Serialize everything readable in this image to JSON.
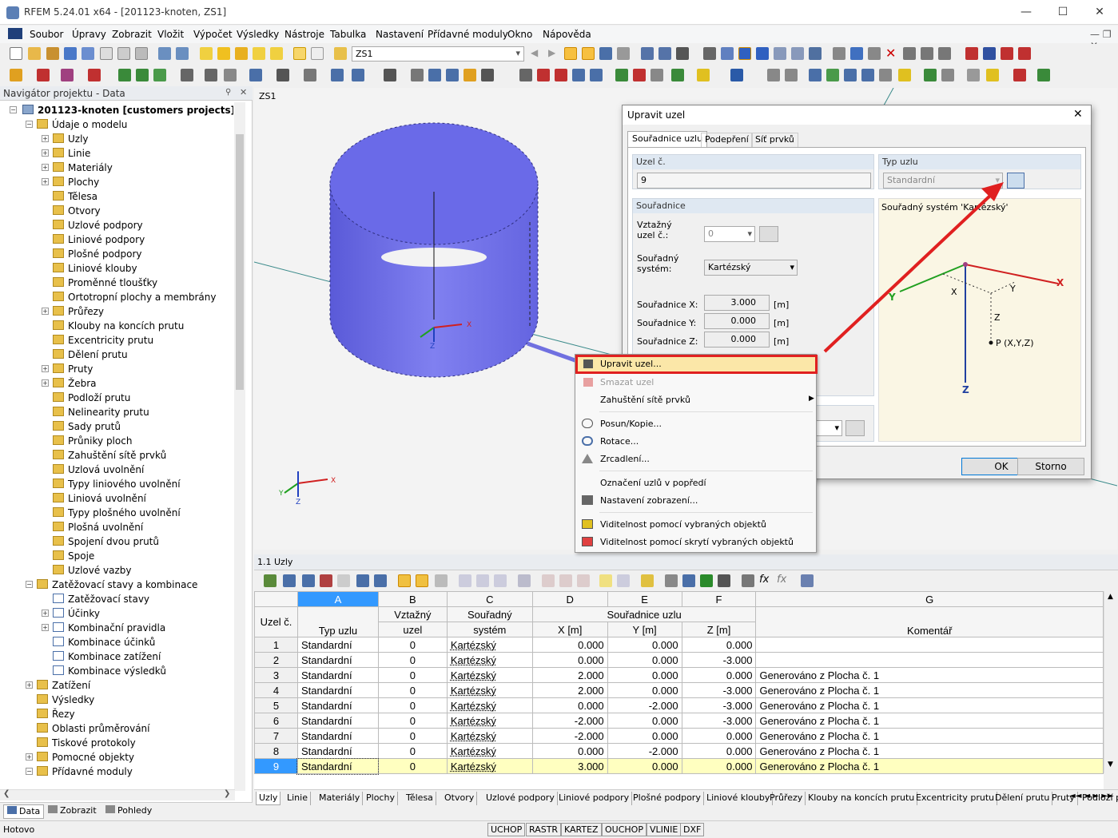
{
  "window": {
    "title": "RFEM 5.24.01 x64 - [201123-knoten, ZS1]"
  },
  "menu": [
    "Soubor",
    "Úpravy",
    "Zobrazit",
    "Vložit",
    "Výpočet",
    "Výsledky",
    "Nástroje",
    "Tabulka",
    "Nastavení",
    "Přídavné moduly",
    "Okno",
    "Nápověda"
  ],
  "toolbar": {
    "loadcase": "ZS1"
  },
  "navigator": {
    "header": "Navigátor projektu - Data",
    "root": "201123-knoten [customers projects]",
    "items": [
      "Údaje o modelu",
      "Uzly",
      "Linie",
      "Materiály",
      "Plochy",
      "Tělesa",
      "Otvory",
      "Uzlové podpory",
      "Liniové podpory",
      "Plošné podpory",
      "Liniové klouby",
      "Proměnné tloušťky",
      "Ortotropní plochy a membrány",
      "Průřezy",
      "Klouby na koncích prutu",
      "Excentricity prutu",
      "Dělení prutu",
      "Pruty",
      "Žebra",
      "Podloží prutu",
      "Nelinearity prutu",
      "Sady prutů",
      "Průniky ploch",
      "Zahuštění sítě prvků",
      "Uzlová uvolnění",
      "Typy liniového uvolnění",
      "Liniová uvolnění",
      "Typy plošného uvolnění",
      "Plošná uvolnění",
      "Spojení dvou prutů",
      "Spoje",
      "Uzlové vazby",
      "Zatěžovací stavy a kombinace",
      "Zatěžovací stavy",
      "Účinky",
      "Kombinační pravidla",
      "Kombinace účinků",
      "Kombinace zatížení",
      "Kombinace výsledků",
      "Zatížení",
      "Výsledky",
      "Řezy",
      "Oblasti průměrování",
      "Tiskové protokoly",
      "Pomocné objekty",
      "Přídavné moduly"
    ],
    "tabs": [
      "Data",
      "Zobrazit",
      "Pohledy"
    ]
  },
  "view": {
    "label": "ZS1",
    "axes": {
      "x": "X",
      "y": "Y",
      "z": "Z"
    }
  },
  "dialog": {
    "title": "Upravit uzel",
    "tabs": [
      "Souřadnice uzlu",
      "Podepření",
      "Síť prvků"
    ],
    "node_no_label": "Uzel č.",
    "node_no": "9",
    "type_label": "Typ uzlu",
    "type_value": "Standardní",
    "coords_label": "Souřadnice",
    "ref_node_label_1": "Vztažný",
    "ref_node_label_2": "uzel č.:",
    "ref_node_value": "0",
    "cs_label_1": "Souřadný",
    "cs_label_2": "systém:",
    "cs_value": "Kartézský",
    "x_label": "Souřadnice X:",
    "x_value": "3.000",
    "y_label": "Souřadnice Y:",
    "y_value": "0.000",
    "z_label": "Souřadnice Z:",
    "z_value": "0.000",
    "unit": "[m]",
    "preview_title": "Souřadný systém 'Kartézský'",
    "preview": {
      "x": "X",
      "y": "Y",
      "z": "Z",
      "p": "P (X,Y,Z)"
    },
    "ok": "OK",
    "cancel": "Storno"
  },
  "context_menu": [
    "Upravit uzel...",
    "Smazat uzel",
    "Zahuštění sítě prvků",
    "Posun/Kopie...",
    "Rotace...",
    "Zrcadlení...",
    "Označení uzlů v popředí",
    "Nastavení zobrazení...",
    "Viditelnost pomocí vybraných objektů",
    "Viditelnost pomocí skrytí vybraných objektů"
  ],
  "table": {
    "title": "1.1 Uzly",
    "col_letters": [
      "A",
      "B",
      "C",
      "D",
      "E",
      "F",
      "G"
    ],
    "headers": {
      "node": "Uzel č.",
      "type": "Typ uzlu",
      "ref1": "Vztažný",
      "ref2": "uzel",
      "cs1": "Souřadný",
      "cs2": "systém",
      "coords": "Souřadnice uzlu",
      "x": "X [m]",
      "y": "Y [m]",
      "z": "Z [m]",
      "comment": "Komentář"
    },
    "rows": [
      [
        "1",
        "Standardní",
        "0",
        "Kartézský",
        "0.000",
        "0.000",
        "0.000",
        ""
      ],
      [
        "2",
        "Standardní",
        "0",
        "Kartézský",
        "0.000",
        "0.000",
        "-3.000",
        ""
      ],
      [
        "3",
        "Standardní",
        "0",
        "Kartézský",
        "2.000",
        "0.000",
        "0.000",
        "Generováno z Plocha č. 1"
      ],
      [
        "4",
        "Standardní",
        "0",
        "Kartézský",
        "2.000",
        "0.000",
        "-3.000",
        "Generováno z Plocha č. 1"
      ],
      [
        "5",
        "Standardní",
        "0",
        "Kartézský",
        "0.000",
        "-2.000",
        "-3.000",
        "Generováno z Plocha č. 1"
      ],
      [
        "6",
        "Standardní",
        "0",
        "Kartézský",
        "-2.000",
        "0.000",
        "-3.000",
        "Generováno z Plocha č. 1"
      ],
      [
        "7",
        "Standardní",
        "0",
        "Kartézský",
        "-2.000",
        "0.000",
        "0.000",
        "Generováno z Plocha č. 1"
      ],
      [
        "8",
        "Standardní",
        "0",
        "Kartézský",
        "0.000",
        "-2.000",
        "0.000",
        "Generováno z Plocha č. 1"
      ],
      [
        "9",
        "Standardní",
        "0",
        "Kartézský",
        "3.000",
        "0.000",
        "0.000",
        "Generováno z Plocha č. 1"
      ]
    ],
    "tabs": [
      "Uzly",
      "Linie",
      "Materiály",
      "Plochy",
      "Tělesa",
      "Otvory",
      "Uzlové podpory",
      "Liniové podpory",
      "Plošné podpory",
      "Liniové klouby",
      "Průřezy",
      "Klouby na koncích prutu",
      "Excentricity prutu",
      "Dělení prutu",
      "Pruty",
      "Podloží prutu"
    ]
  },
  "status": {
    "text": "Hotovo",
    "buttons": [
      "UCHOP",
      "RASTR",
      "KARTEZ",
      "OUCHOP",
      "VLINIE",
      "DXF"
    ]
  },
  "colors": {
    "highlight_red": "#e02020",
    "selection_blue": "#3399ff",
    "row_yellow": "#ffffc0"
  }
}
